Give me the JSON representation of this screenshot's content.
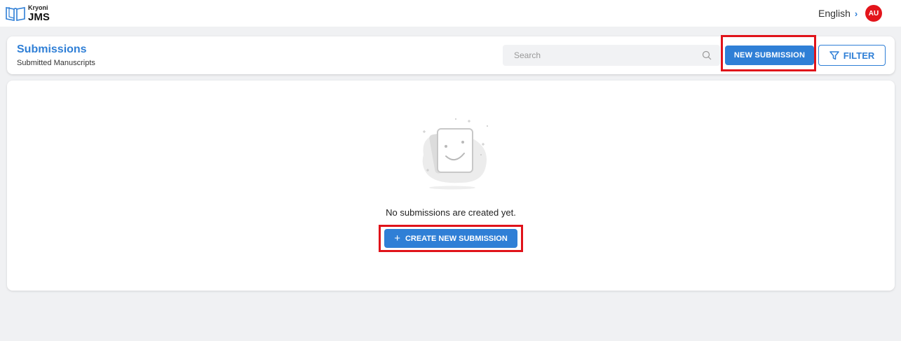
{
  "app": {
    "brand_small": "Kryoni",
    "brand_big": "JMS",
    "language": "English",
    "user_initials": "AU"
  },
  "header": {
    "title": "Submissions",
    "subtitle": "Submitted Manuscripts",
    "search_placeholder": "Search",
    "search_value": "",
    "new_submission_label": "NEW SUBMISSION",
    "filter_label": "FILTER"
  },
  "empty_state": {
    "message": "No submissions are created yet.",
    "create_label": "CREATE NEW SUBMISSION"
  },
  "icons": {
    "logo": "book-icon",
    "language_chevron": "chevron-right-icon",
    "search": "search-icon",
    "filter": "filter-icon",
    "plus": "plus-icon",
    "empty": "smiley-card-illustration"
  },
  "colors": {
    "accent": "#2f7fd6",
    "avatar": "#e3151b",
    "highlight": "#e0131a",
    "background": "#f0f1f3"
  }
}
